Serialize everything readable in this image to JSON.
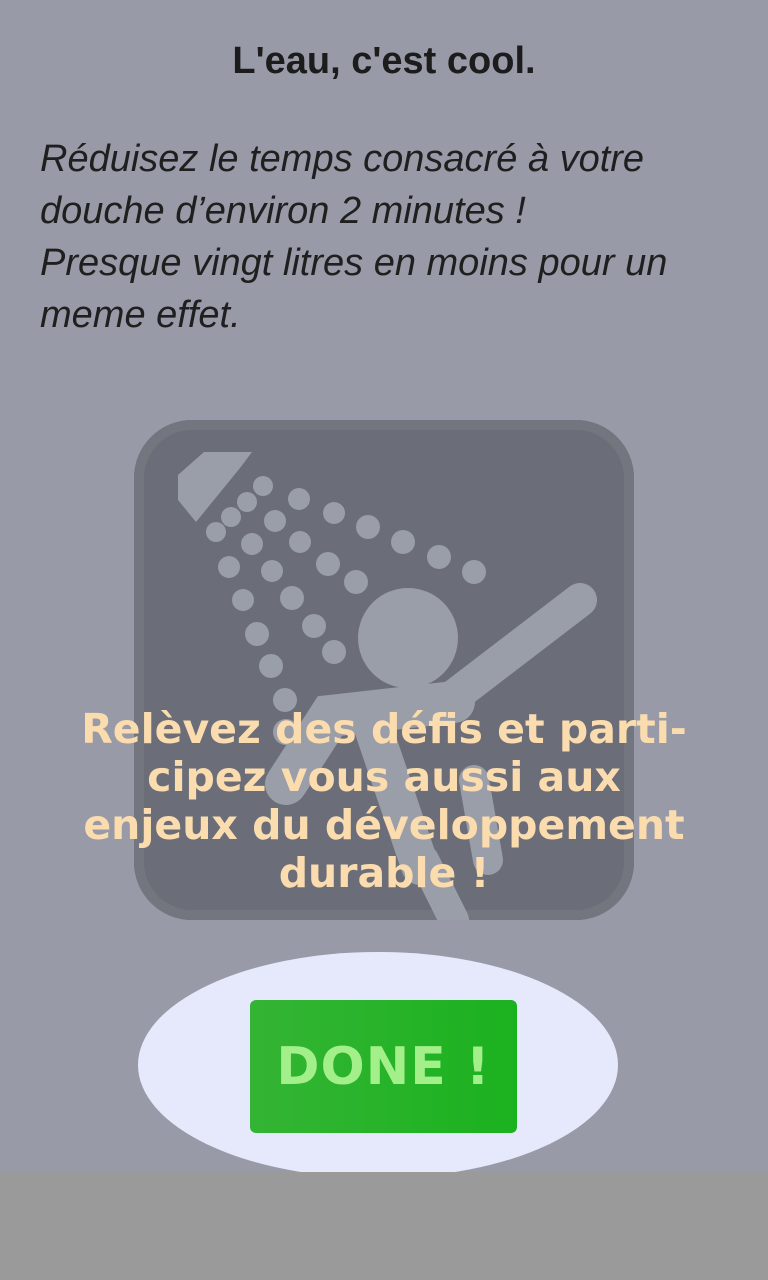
{
  "header": {
    "title": "L'eau, c'est cool."
  },
  "content": {
    "description": "Réduisez le temps consacré à votre\ndouche d’environ 2 minutes !\nPresque vingt litres en moins pour un\nmeme effet.",
    "tagline": "Relèvez des défis et parti-\ncipez vous aussi aux\nenjeux du développement\ndurable !",
    "icon": "shower-icon"
  },
  "actions": {
    "done_label": "DONE !"
  },
  "colors": {
    "background": "#989ba7",
    "card": "#6b6e78",
    "tagline": "#fbdcae",
    "done_button": "#1bb21f",
    "done_text": "#a3f08a",
    "halo": "#e6e9fb"
  }
}
